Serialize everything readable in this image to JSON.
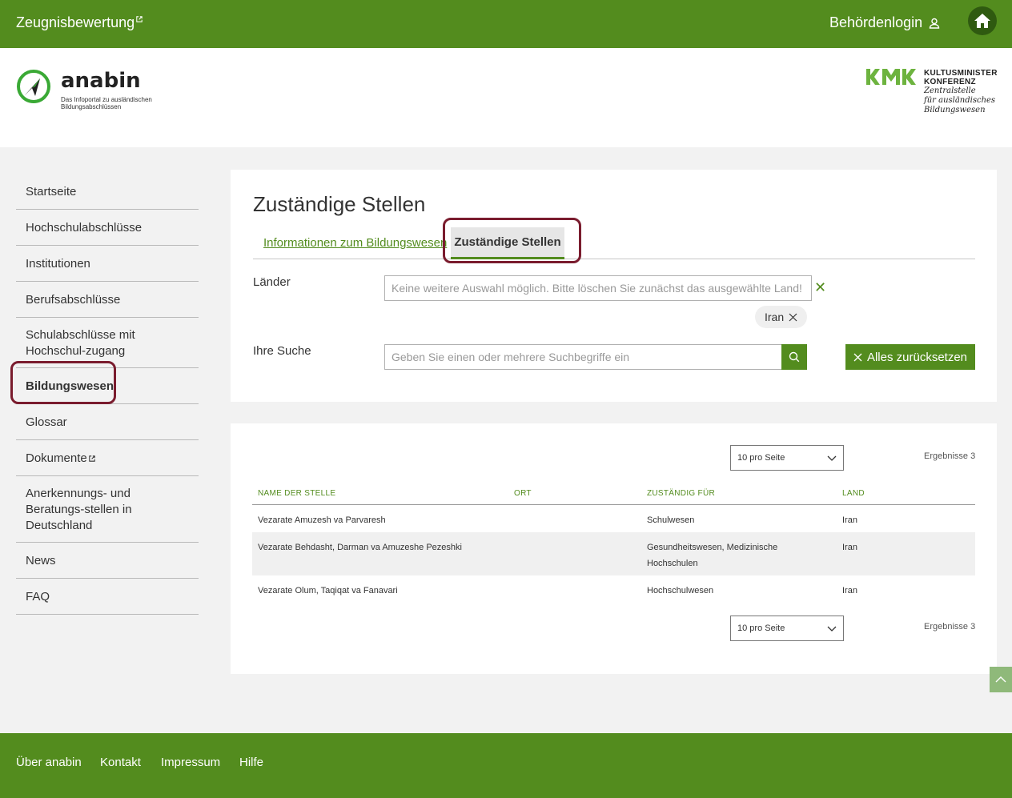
{
  "topbar": {
    "left_link": "Zeugnisbewertung",
    "login": "Behördenlogin"
  },
  "header": {
    "logo_name": "anabin",
    "logo_sub": "Das Infoportal zu ausländischen Bildungsabschlüssen",
    "kmk_line1": "KULTUSMINISTER",
    "kmk_line2": "KONFERENZ",
    "kmk_line3": "Zentralstelle",
    "kmk_line4": "für ausländisches",
    "kmk_line5": "Bildungswesen"
  },
  "sidebar": {
    "items": [
      {
        "label": "Startseite"
      },
      {
        "label": "Hochschulabschlüsse"
      },
      {
        "label": "Institutionen"
      },
      {
        "label": "Berufsabschlüsse"
      },
      {
        "label": "Schulabschlüsse mit Hochschul-zugang"
      },
      {
        "label": "Bildungswesen"
      },
      {
        "label": "Glossar"
      },
      {
        "label": "Dokumente"
      },
      {
        "label": "Anerkennungs- und Beratungs-stellen in Deutschland"
      },
      {
        "label": "News"
      },
      {
        "label": "FAQ"
      }
    ]
  },
  "main": {
    "title": "Zuständige Stellen",
    "tabs": [
      {
        "label": "Informationen zum Bildungswesen"
      },
      {
        "label": "Zuständige Stellen"
      }
    ],
    "countries_label": "Länder",
    "countries_placeholder": "Keine weitere Auswahl möglich. Bitte löschen Sie zunächst das ausgewählte Land!",
    "chip": "Iran",
    "search_label": "Ihre Suche",
    "search_placeholder": "Geben Sie einen oder mehrere Suchbegriffe ein",
    "reset_label": "Alles zurücksetzen"
  },
  "results": {
    "per_page": "10 pro Seite",
    "count": "Ergebnisse 3",
    "columns": [
      "NAME DER STELLE",
      "ORT",
      "ZUSTÄNDIG FÜR",
      "LAND"
    ],
    "rows": [
      [
        "Vezarate Amuzesh va Parvaresh",
        "",
        "Schulwesen",
        "Iran"
      ],
      [
        "Vezarate Behdasht, Darman va Amuzeshe Pezeshki",
        "",
        "Gesundheitswesen, Medizinische Hochschulen",
        "Iran"
      ],
      [
        "Vezarate Olum, Taqiqat va Fanavari",
        "",
        "Hochschulwesen",
        "Iran"
      ]
    ]
  },
  "footer": {
    "links": [
      "Über anabin",
      "Kontakt",
      "Impressum",
      "Hilfe"
    ]
  }
}
